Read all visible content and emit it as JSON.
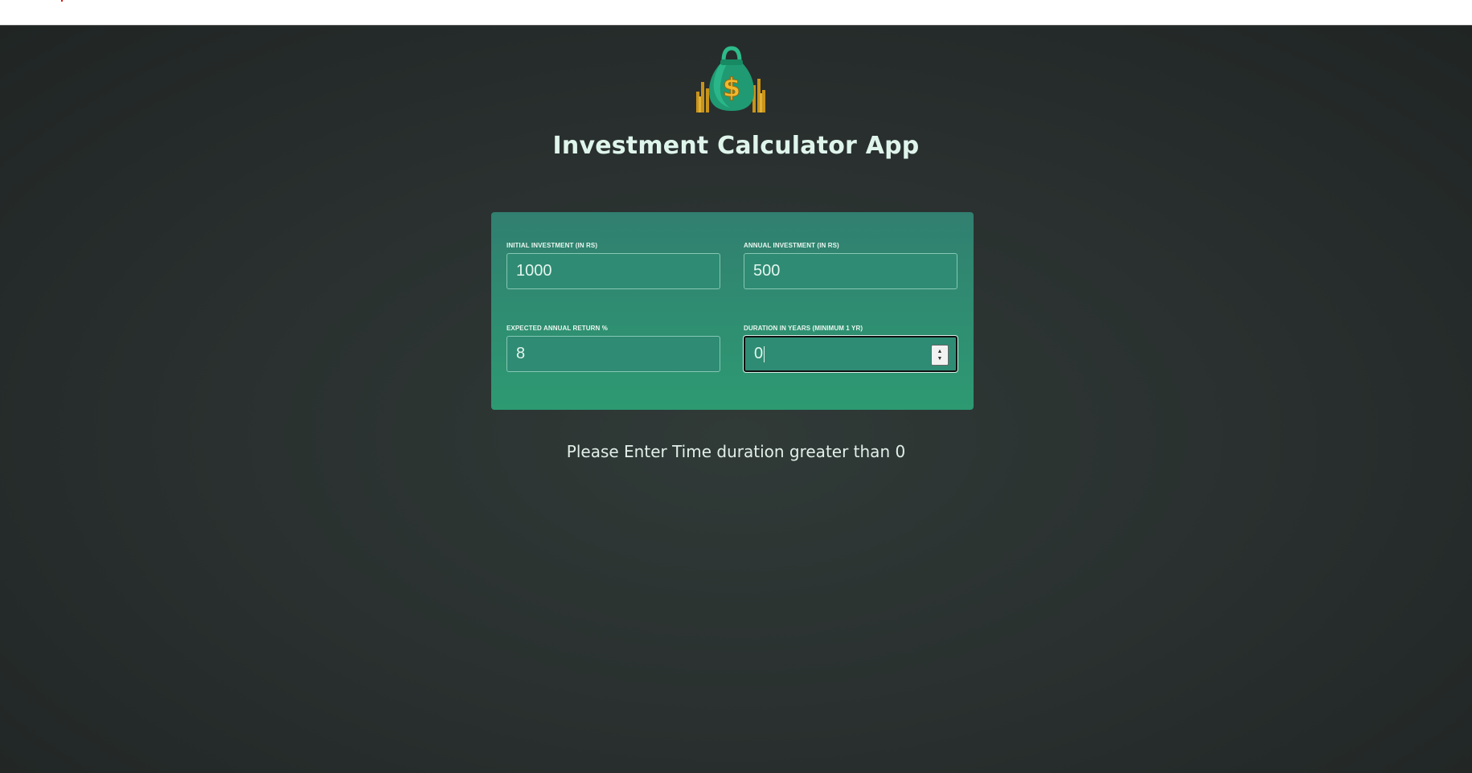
{
  "app": {
    "title": "Investment Calculator App",
    "logo_icon": "money-bag-icon",
    "colors": {
      "background": "#2a3130",
      "card_top": "#317f70",
      "card_bottom": "#2d9a72",
      "title": "#dff5ec"
    }
  },
  "form": {
    "initial_investment": {
      "label": "INITIAL INVESTMENT (IN RS)",
      "value": "1000"
    },
    "annual_investment": {
      "label": "ANNUAL INVESTMENT (IN RS)",
      "value": "500"
    },
    "expected_return": {
      "label": "EXPECTED ANNUAL RETURN %",
      "value": "8"
    },
    "duration": {
      "label": "DURATION IN YEARS (MINIMUM 1 YR)",
      "value": "0"
    }
  },
  "message": "Please Enter Time duration greater than 0"
}
